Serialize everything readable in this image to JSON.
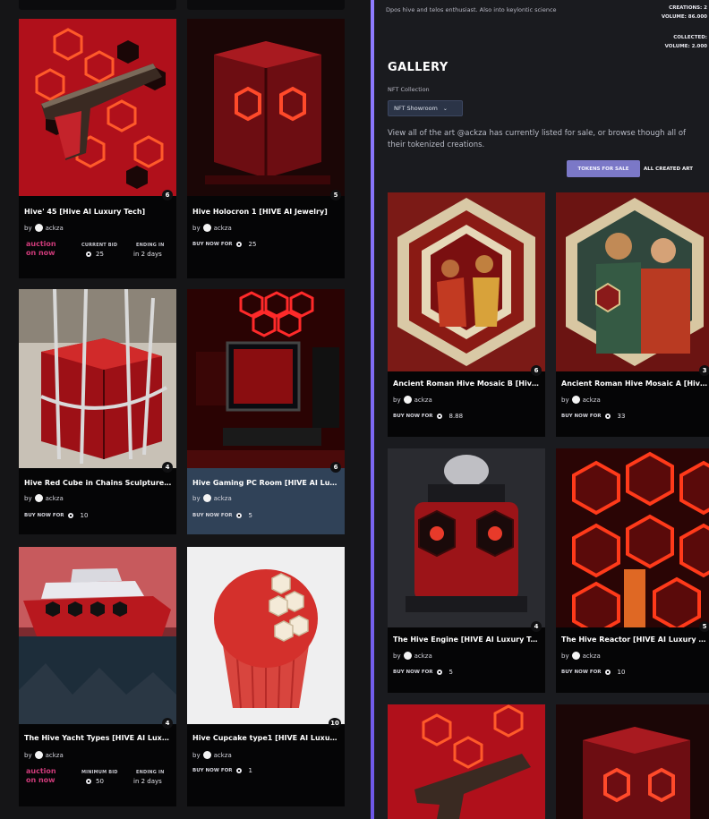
{
  "left_cards": [
    {
      "title": "Hive' 45 [Hive AI Luxury Tech]",
      "count": "6",
      "by_prefix": "by",
      "creator": "ackza",
      "type": "auction",
      "auction_label": [
        "auction",
        "on now"
      ],
      "bid_label": "CURRENT BID",
      "bid_value": "25",
      "ending_label": "ENDING IN",
      "ending_value": "in 2 days"
    },
    {
      "title": "Hive Holocron 1 [HIVE AI Jewelry]",
      "count": "5",
      "by_prefix": "by",
      "creator": "ackza",
      "type": "buy",
      "buy_label": "BUY NOW FOR",
      "price": "25"
    },
    {
      "title": "Hive Red Cube in Chains Sculpture [...",
      "count": "4",
      "by_prefix": "by",
      "creator": "ackza",
      "type": "buy",
      "buy_label": "BUY NOW FOR",
      "price": "10"
    },
    {
      "title": "Hive Gaming PC Room [HIVE AI Luxu...",
      "count": "6",
      "by_prefix": "by",
      "creator": "ackza",
      "type": "buy",
      "buy_label": "BUY NOW FOR",
      "price": "5"
    },
    {
      "title": "The Hive Yacht Types [HIVE AI Luxur...",
      "count": "4",
      "by_prefix": "by",
      "creator": "ackza",
      "type": "auction",
      "auction_label": [
        "auction",
        "on now"
      ],
      "bid_label": "MINIMUM BID",
      "bid_value": "50",
      "ending_label": "ENDING IN",
      "ending_value": "in 2 days"
    },
    {
      "title": "Hive Cupcake type1 [HIVE AI Luxury ...",
      "count": "10",
      "by_prefix": "by",
      "creator": "ackza",
      "type": "buy",
      "buy_label": "BUY NOW FOR",
      "price": "1"
    }
  ],
  "profile": {
    "bio": "Dpos hive and telos enthusiast. Also into keylontic science",
    "creations": "CREATIONS: 2",
    "volume1": "VOLUME: 86.000",
    "collected": "COLLECTED:",
    "volume2": "VOLUME: 2.000"
  },
  "gallery": {
    "title": "GALLERY",
    "collection_label": "NFT Collection",
    "collection_value": "NFT Showroom",
    "description": "View all of the art @ackza has currently listed for sale, or browse though all of their tokenized creations.",
    "tab_sale": "TOKENS FOR SALE",
    "tab_all": "ALL CREATED ART"
  },
  "right_cards": [
    {
      "title": "Ancient Roman Hive Mosaic B [Hive ...",
      "count": "6",
      "by_prefix": "by",
      "creator": "ackza",
      "buy_label": "BUY NOW FOR",
      "price": "8.88"
    },
    {
      "title": "Ancient Roman Hive Mosaic A [Hive ...",
      "count": "3",
      "by_prefix": "by",
      "creator": "ackza",
      "buy_label": "BUY NOW FOR",
      "price": "33"
    },
    {
      "title": "The Hive Engine [HIVE AI Luxury Tech]",
      "count": "4",
      "by_prefix": "by",
      "creator": "ackza",
      "buy_label": "BUY NOW FOR",
      "price": "5"
    },
    {
      "title": "The Hive Reactor [HIVE AI Luxury Te...",
      "count": "5",
      "by_prefix": "by",
      "creator": "ackza",
      "buy_label": "BUY NOW FOR",
      "price": "10"
    }
  ],
  "colors": {
    "accent": "#7b78c7",
    "divider": "#7d68f0",
    "auction": "#cf3b7a",
    "highlight": "#304258"
  }
}
